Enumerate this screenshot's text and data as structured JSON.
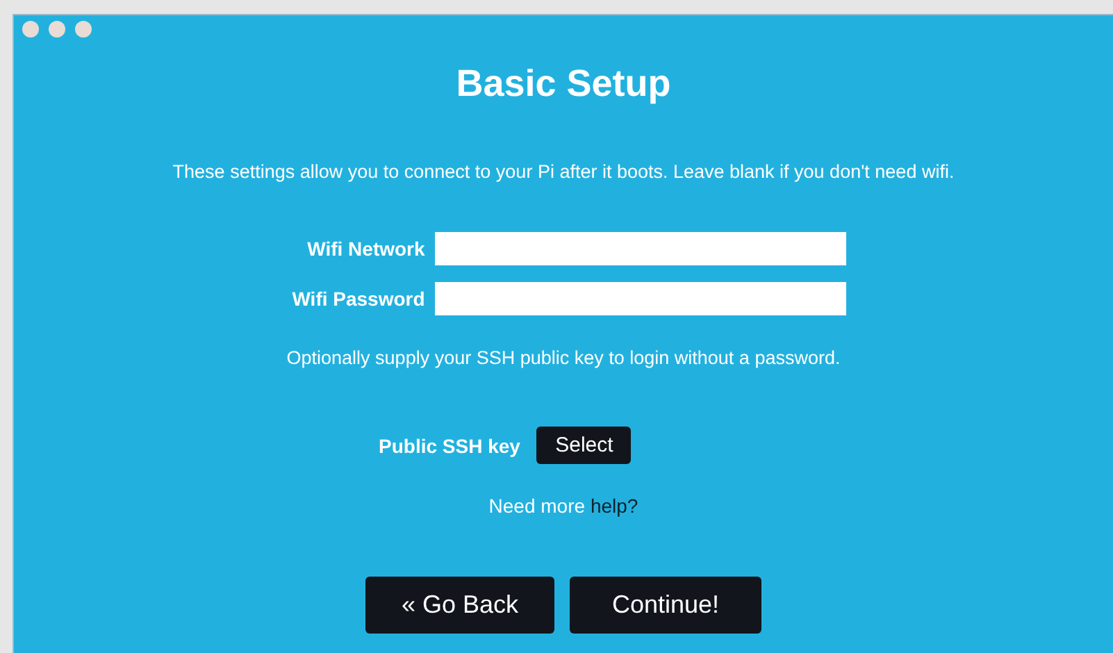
{
  "title": "Basic Setup",
  "intro": "These settings allow you to connect to your Pi after it boots. Leave blank if you don't need wifi.",
  "fields": [
    {
      "label": "Wifi Network"
    },
    {
      "label": "Wifi Password"
    }
  ],
  "ssh_hint": "Optionally supply your SSH public key to login without a password.",
  "ssh_key": {
    "label": "Public SSH key",
    "button": "Select"
  },
  "help": {
    "text": "Need more",
    "link": "help?"
  },
  "buttons": [
    "« Go Back",
    "Continue!"
  ]
}
